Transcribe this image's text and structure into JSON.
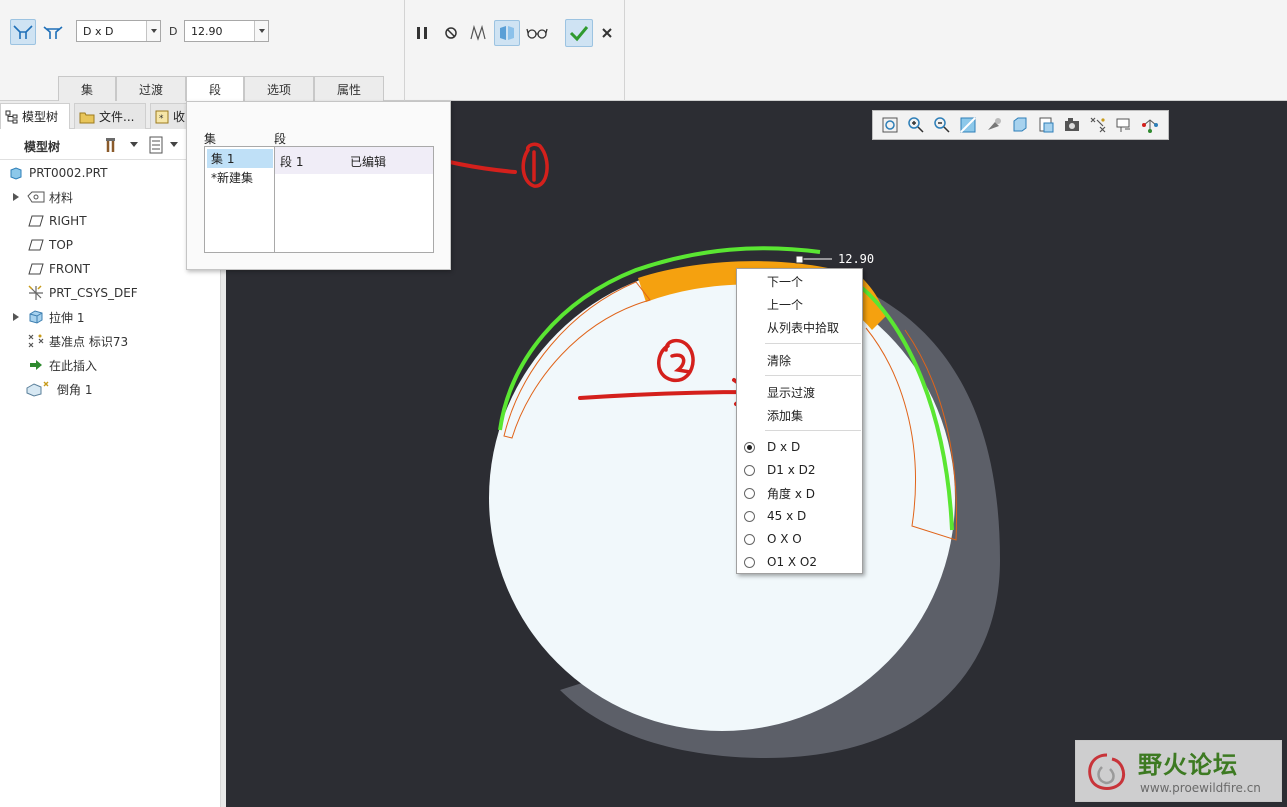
{
  "ribbon": {
    "combo_type": "D x D",
    "d_label": "D",
    "d_value": "12.90",
    "tabs": [
      "集",
      "过渡",
      "段",
      "选项",
      "属性"
    ],
    "active_tab": "段"
  },
  "panel": {
    "tabs": [
      "模型树",
      "文件...",
      "收"
    ],
    "title": "模型树"
  },
  "tree": [
    {
      "label": "PRT0002.PRT",
      "icon": "part-icon"
    },
    {
      "label": "材料",
      "icon": "material-icon"
    },
    {
      "label": "RIGHT",
      "icon": "datum-plane-icon"
    },
    {
      "label": "TOP",
      "icon": "datum-plane-icon"
    },
    {
      "label": "FRONT",
      "icon": "datum-plane-icon"
    },
    {
      "label": "PRT_CSYS_DEF",
      "icon": "csys-icon"
    },
    {
      "label": "拉伸 1",
      "icon": "extrude-icon"
    },
    {
      "label": "基准点 标识73",
      "icon": "datum-point-icon"
    },
    {
      "label": "在此插入",
      "icon": "insert-arrow-icon"
    },
    {
      "label": "倒角 1",
      "icon": "chamfer-icon"
    }
  ],
  "sets_popup": {
    "sets_header": "集",
    "segments_header": "段",
    "sets": [
      "集 1",
      "*新建集"
    ],
    "segment": {
      "name": "段 1",
      "status": "已编辑"
    }
  },
  "context_menu": {
    "items": [
      "下一个",
      "上一个",
      "从列表中拾取"
    ],
    "clear": "清除",
    "items2": [
      "显示过渡",
      "添加集"
    ],
    "options": [
      "D x D",
      "D1 x D2",
      "角度 x D",
      "45 x D",
      "O X O",
      "O1 X O2"
    ],
    "selected_option": "D x D"
  },
  "dimension": "12.90",
  "annotations": {
    "one": "①",
    "two": "②"
  },
  "watermark": {
    "title": "野火论坛",
    "url": "www.proewildfire.cn"
  },
  "colors": {
    "viewport_bg": "#2c2d33",
    "part_face": "#f1f8fb",
    "shadow": "#5b5e66",
    "edge_green": "#5ae632",
    "chamfer_orange": "#f5a10f",
    "annotation_red": "#d4201c",
    "selection_blue": "#bfe0f7"
  }
}
